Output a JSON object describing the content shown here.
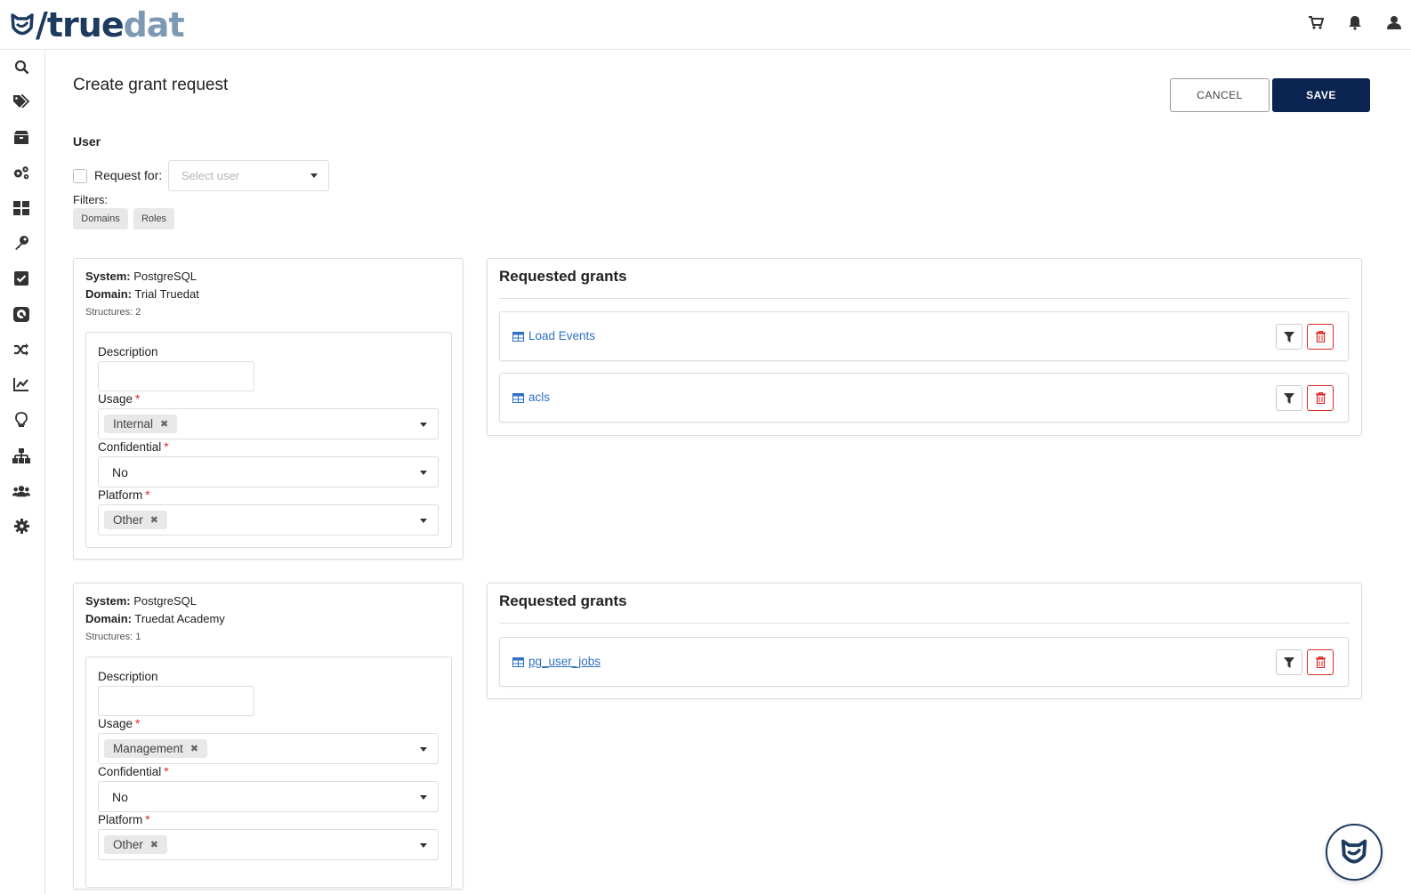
{
  "app": {
    "logo_text_a": "/true",
    "logo_text_b": "dat"
  },
  "header": {
    "icons": [
      "cart-icon",
      "bell-icon",
      "user-icon"
    ]
  },
  "sidebar": {
    "items": [
      "search-icon",
      "tags-icon",
      "box-icon",
      "cogs-icon",
      "grid-icon",
      "key-icon",
      "check-square-icon",
      "disk-icon",
      "shuffle-icon",
      "chart-line-icon",
      "lightbulb-icon",
      "sitemap-icon",
      "users-icon",
      "gear-icon"
    ]
  },
  "page": {
    "title": "Create grant request",
    "cancel_label": "CANCEL",
    "save_label": "SAVE"
  },
  "user_section": {
    "title": "User",
    "request_for_label": "Request for:",
    "select_user_placeholder": "Select user",
    "filters_label": "Filters:",
    "filters": [
      "Domains",
      "Roles"
    ]
  },
  "groups": [
    {
      "system_label": "System:",
      "system": "PostgreSQL",
      "domain_label": "Domain:",
      "domain": "Trial Truedat",
      "structures": "Structures: 2",
      "description_label": "Description",
      "usage_label": "Usage",
      "usage_value": "Internal",
      "confidential_label": "Confidential",
      "confidential_value": "No",
      "platform_label": "Platform",
      "platform_value": "Other",
      "grants_title": "Requested grants",
      "grants": [
        "Load Events",
        "acls"
      ]
    },
    {
      "system_label": "System:",
      "system": "PostgreSQL",
      "domain_label": "Domain:",
      "domain": "Truedat Academy",
      "structures": "Structures: 1",
      "description_label": "Description",
      "usage_label": "Usage",
      "usage_value": "Management",
      "confidential_label": "Confidential",
      "confidential_value": "No",
      "platform_label": "Platform",
      "platform_value": "Other",
      "grants_title": "Requested grants",
      "grants": [
        "pg_user_jobs"
      ]
    }
  ],
  "colors": {
    "brand_dark": "#0b2350",
    "link": "#2e70c2",
    "danger": "#db2828"
  }
}
